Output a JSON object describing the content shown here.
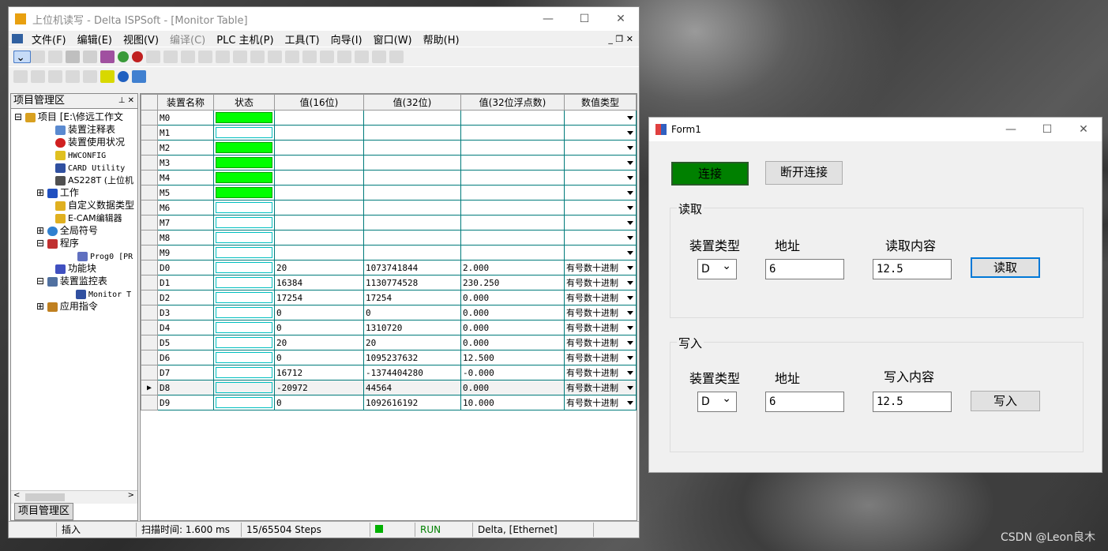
{
  "isp": {
    "title": "上位机读写 - Delta ISPSoft - [Monitor Table]",
    "menus": [
      "文件(F)",
      "编辑(E)",
      "视图(V)",
      "编译(C)",
      "PLC 主机(P)",
      "工具(T)",
      "向导(I)",
      "窗口(W)",
      "帮助(H)"
    ],
    "project_panel_title": "项目管理区",
    "project_tab": "项目管理区",
    "tree": [
      "项目 [E:\\修远工作文",
      "装置注释表",
      "装置使用状况",
      "HWCONFIG",
      "CARD Utility",
      "AS228T (上位机",
      "工作",
      "自定义数据类型",
      "E-CAM编辑器",
      "全局符号",
      "程序",
      "Prog0 [PR",
      "功能块",
      "装置监控表",
      "Monitor T",
      "应用指令"
    ],
    "columns": [
      "装置名称",
      "状态",
      "值(16位)",
      "值(32位)",
      "值(32位浮点数)",
      "数值类型"
    ],
    "rows": [
      {
        "name": "M0",
        "on": true,
        "v16": "",
        "v32": "",
        "vf": "",
        "type": ""
      },
      {
        "name": "M1",
        "on": false,
        "v16": "",
        "v32": "",
        "vf": "",
        "type": ""
      },
      {
        "name": "M2",
        "on": true,
        "v16": "",
        "v32": "",
        "vf": "",
        "type": ""
      },
      {
        "name": "M3",
        "on": true,
        "v16": "",
        "v32": "",
        "vf": "",
        "type": ""
      },
      {
        "name": "M4",
        "on": true,
        "v16": "",
        "v32": "",
        "vf": "",
        "type": ""
      },
      {
        "name": "M5",
        "on": true,
        "v16": "",
        "v32": "",
        "vf": "",
        "type": ""
      },
      {
        "name": "M6",
        "on": false,
        "v16": "",
        "v32": "",
        "vf": "",
        "type": ""
      },
      {
        "name": "M7",
        "on": false,
        "v16": "",
        "v32": "",
        "vf": "",
        "type": ""
      },
      {
        "name": "M8",
        "on": false,
        "v16": "",
        "v32": "",
        "vf": "",
        "type": ""
      },
      {
        "name": "M9",
        "on": false,
        "v16": "",
        "v32": "",
        "vf": "",
        "type": ""
      },
      {
        "name": "D0",
        "on": false,
        "v16": "20",
        "v32": "1073741844",
        "vf": "2.000",
        "type": "有号数十进制"
      },
      {
        "name": "D1",
        "on": false,
        "v16": "16384",
        "v32": "1130774528",
        "vf": "230.250",
        "type": "有号数十进制"
      },
      {
        "name": "D2",
        "on": false,
        "v16": "17254",
        "v32": "17254",
        "vf": "0.000",
        "type": "有号数十进制"
      },
      {
        "name": "D3",
        "on": false,
        "v16": "0",
        "v32": "0",
        "vf": "0.000",
        "type": "有号数十进制"
      },
      {
        "name": "D4",
        "on": false,
        "v16": "0",
        "v32": "1310720",
        "vf": "0.000",
        "type": "有号数十进制"
      },
      {
        "name": "D5",
        "on": false,
        "v16": "20",
        "v32": "20",
        "vf": "0.000",
        "type": "有号数十进制"
      },
      {
        "name": "D6",
        "on": false,
        "v16": "0",
        "v32": "1095237632",
        "vf": "12.500",
        "type": "有号数十进制"
      },
      {
        "name": "D7",
        "on": false,
        "v16": "16712",
        "v32": "-1374404280",
        "vf": "-0.000",
        "type": "有号数十进制"
      },
      {
        "name": "D8",
        "on": false,
        "v16": "-20972",
        "v32": "44564",
        "vf": "0.000",
        "type": "有号数十进制",
        "current": true
      },
      {
        "name": "D9",
        "on": false,
        "v16": "0",
        "v32": "1092616192",
        "vf": "10.000",
        "type": "有号数十进制"
      }
    ],
    "status": {
      "mode": "插入",
      "scan": "扫描时间: 1.600 ms",
      "steps": "15/65504 Steps",
      "run": "RUN",
      "conn": "Delta, [Ethernet]"
    }
  },
  "form1": {
    "title": "Form1",
    "connect": "连接",
    "disconnect": "断开连接",
    "read_group": "读取",
    "write_group": "写入",
    "device_type_label": "装置类型",
    "address_label": "地址",
    "read_content_label": "读取内容",
    "write_content_label": "写入内容",
    "read_device": "D",
    "read_address": "6",
    "read_value": "12.5",
    "read_button": "读取",
    "write_device": "D",
    "write_address": "6",
    "write_value": "12.5",
    "write_button": "写入",
    "accent": "#008000"
  },
  "watermark": "CSDN @Leon良木"
}
